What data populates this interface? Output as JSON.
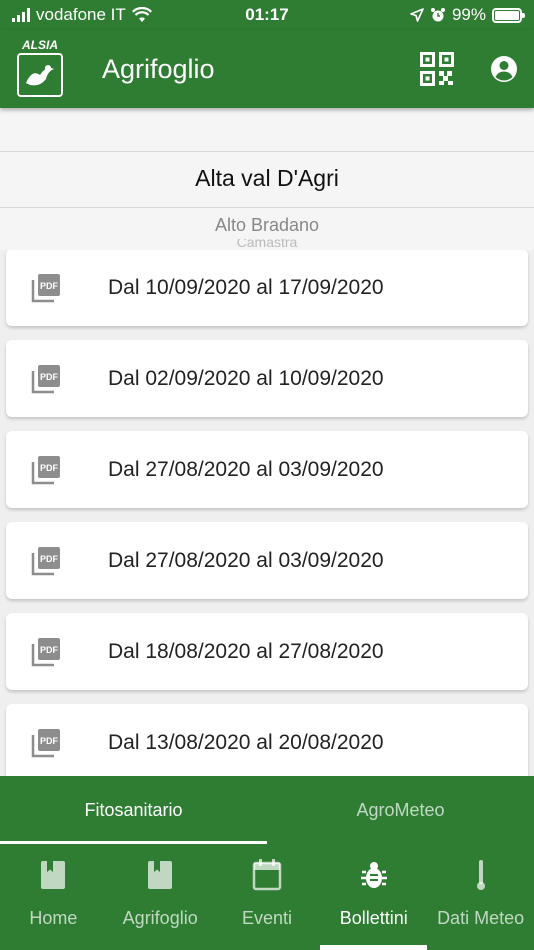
{
  "status": {
    "carrier": "vodafone IT",
    "time": "01:17",
    "battery": "99%"
  },
  "app_bar": {
    "logo_text": "ALSIA",
    "title": "Agrifoglio",
    "qr_icon": "qr-code-icon",
    "account_icon": "account-circle-icon"
  },
  "picker": {
    "selected": "Alta val D'Agri",
    "next": "Alto Bradano",
    "faded": "Camastra"
  },
  "bulletins": [
    {
      "label": "Dal 10/09/2020 al 17/09/2020",
      "icon": "pdf-icon"
    },
    {
      "label": "Dal 02/09/2020 al 10/09/2020",
      "icon": "pdf-icon"
    },
    {
      "label": "Dal 27/08/2020 al 03/09/2020",
      "icon": "pdf-icon"
    },
    {
      "label": "Dal 27/08/2020 al 03/09/2020",
      "icon": "pdf-icon"
    },
    {
      "label": "Dal 18/08/2020 al 27/08/2020",
      "icon": "pdf-icon"
    },
    {
      "label": "Dal 13/08/2020 al 20/08/2020",
      "icon": "pdf-icon"
    }
  ],
  "tabs": [
    {
      "label": "Fitosanitario",
      "active": true
    },
    {
      "label": "AgroMeteo",
      "active": false
    }
  ],
  "nav": [
    {
      "label": "Home",
      "icon": "book-icon",
      "active": false
    },
    {
      "label": "Agrifoglio",
      "icon": "book-icon",
      "active": false
    },
    {
      "label": "Eventi",
      "icon": "calendar-icon",
      "active": false
    },
    {
      "label": "Bollettini",
      "icon": "bug-icon",
      "active": true
    },
    {
      "label": "Dati Meteo",
      "icon": "thermometer-icon",
      "active": false
    }
  ],
  "colors": {
    "primary": "#2e7d32",
    "background": "#efefef",
    "card": "#ffffff"
  }
}
